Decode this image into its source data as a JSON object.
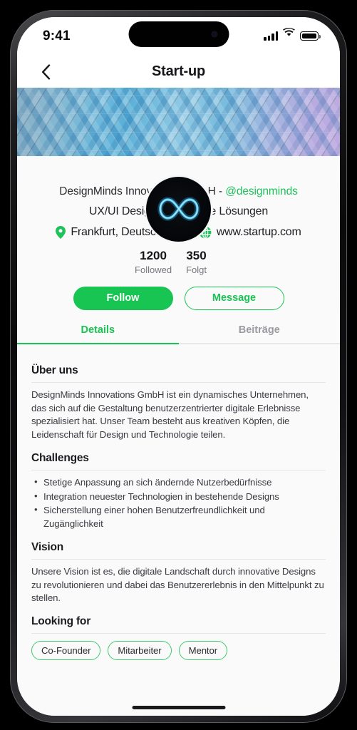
{
  "status_bar": {
    "time": "9:41",
    "signal_icon": "cellular-signal-icon",
    "wifi_icon": "wifi-icon",
    "battery_icon": "battery-full-icon"
  },
  "header": {
    "title": "Start-up",
    "back_icon": "chevron-left-icon"
  },
  "cover": {
    "image_name": "geometric-architecture-cover-photo",
    "dominant_colors": [
      "#5ab0d8",
      "#9fd0e6",
      "#cbb6e8"
    ]
  },
  "avatar": {
    "image_name": "infinity-logo-avatar",
    "background": "#05070a",
    "glyph_color": "#49b8e8"
  },
  "profile": {
    "company_name": "DesignMinds Innovations GmbH",
    "separator": " - ",
    "handle": "@designminds",
    "tagline": "UX/UI Design und digitale Lösungen",
    "location": {
      "icon": "map-pin-icon",
      "text": "Frankfurt, Deutschland"
    },
    "website": {
      "icon": "globe-icon",
      "text": "www.startup.com"
    },
    "stats": [
      {
        "value": "1200",
        "label": "Followed"
      },
      {
        "value": "350",
        "label": "Folgt"
      }
    ]
  },
  "actions": {
    "follow_label": "Follow",
    "message_label": "Message"
  },
  "tabs": [
    {
      "label": "Details",
      "active": true
    },
    {
      "label": "Beiträge",
      "active": false
    }
  ],
  "sections": {
    "about": {
      "title": "Über uns",
      "body": "DesignMinds Innovations GmbH ist ein dynamisches Unternehmen, das sich auf die Gestaltung benutzerzentrierter digitale Erlebnisse spezialisiert hat. Unser Team besteht aus kreativen Köpfen, die Leidenschaft für Design und Technologie teilen."
    },
    "challenges": {
      "title": "Challenges",
      "items": [
        "Stetige Anpassung an sich ändernde Nutzerbedürfnisse",
        "Integration neuester Technologien in bestehende Designs",
        "Sicherstellung einer hohen Benutzerfreundlichkeit und Zugänglichkeit"
      ]
    },
    "vision": {
      "title": "Vision",
      "body": "Unsere Vision ist es, die digitale Landschaft durch innovative Designs zu revolutionieren und dabei das Benutzererlebnis in den Mittelpunkt zu stellen."
    },
    "looking_for": {
      "title": "Looking for",
      "tags": [
        "Co-Founder",
        "Mitarbeiter",
        "Mentor"
      ]
    }
  },
  "theme": {
    "accent_green": "#18c452",
    "handle_green": "#1ec15a",
    "tag_border_green": "#3ccb6c",
    "text_primary": "#1b1b20",
    "text_secondary": "#77777e",
    "screen_background": "#fafafa"
  },
  "home_indicator": "home-indicator-bar"
}
